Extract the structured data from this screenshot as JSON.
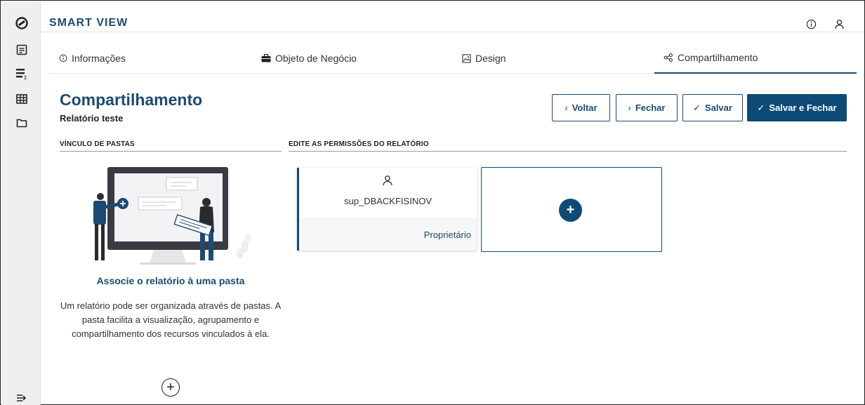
{
  "app": {
    "title": "SMART VIEW"
  },
  "sidebar": {
    "items": [
      {
        "icon": "logo-icon"
      },
      {
        "icon": "report-icon"
      },
      {
        "icon": "report-list-icon"
      },
      {
        "icon": "table-icon"
      },
      {
        "icon": "folder-icon"
      },
      {
        "icon": "expand-sidebar-icon"
      }
    ]
  },
  "header": {
    "icons": [
      "info-icon",
      "user-icon"
    ]
  },
  "tabs": [
    {
      "label": "Informações",
      "icon": "info-icon"
    },
    {
      "label": "Objeto de Negócio",
      "icon": "briefcase-icon"
    },
    {
      "label": "Design",
      "icon": "image-icon"
    },
    {
      "label": "Compartilhamento",
      "icon": "share-icon",
      "active": true
    }
  ],
  "page": {
    "title": "Compartilhamento",
    "subtitle": "Relatório teste"
  },
  "actions": {
    "back_label": "Voltar",
    "close_label": "Fechar",
    "save_label": "Salvar",
    "save_close_label": "Salvar e Fechar"
  },
  "folders": {
    "section_label": "VÍNCULO DE PASTAS",
    "title": "Associe o relatório à uma pasta",
    "description": "Um relatório pode ser organizada através de pastas. A pasta facilita a visualização, agrupamento e compartilhamento dos recursos vinculados à ela."
  },
  "permissions": {
    "section_label": "EDITE AS PERMISSÕES DO RELATÓRIO",
    "users": [
      {
        "name": "sup_DBACKFISINOV",
        "role": "Proprietário"
      }
    ]
  },
  "colors": {
    "primary": "#0e4a76",
    "title": "#1c4b72",
    "sidebar": "#efefef"
  }
}
